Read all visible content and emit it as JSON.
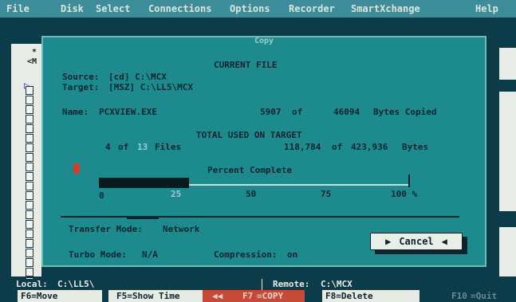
{
  "menu": [
    "File",
    "Disk",
    "Select",
    "Connections",
    "Options",
    "Recorder",
    "SmartXchange",
    "Help"
  ],
  "dialog": {
    "title": "Copy",
    "current_file_heading": "CURRENT FILE",
    "source_label": "Source:",
    "source_value": "[cd] C:\\MCX",
    "target_label": "Target:",
    "target_value": "[MSZ] C:\\LL5\\MCX",
    "name_label": "Name:",
    "name_value": "PCXVIEW.EXE",
    "bytes_copied": "5907",
    "bytes_of": "of",
    "bytes_total": "46094",
    "bytes_suffix": "Bytes Copied",
    "total_heading": "TOTAL USED ON TARGET",
    "files_count": "4",
    "files_of": "of",
    "files_total": "13",
    "files_suffix": "Files",
    "bytes_used": "118,784",
    "bytes_used_of": "of",
    "bytes_capacity": "423,936",
    "bytes_used_suffix": "Bytes",
    "percent_heading": "Percent Complete",
    "percent_value": 0.29,
    "scale": [
      "0",
      "25",
      "50",
      "75",
      "100 %"
    ],
    "transfer_mode_label": "Transfer Mode:",
    "transfer_mode_value": "Network",
    "turbo_mode_label": "Turbo Mode:",
    "turbo_mode_value": "N/A",
    "compression_label": "Compression:",
    "compression_value": "on",
    "cancel_label": "Cancel",
    "cancel_left_icon": "▶",
    "cancel_right_icon": "◀"
  },
  "left_panel": {
    "line1": "*",
    "line2": "<M"
  },
  "status": {
    "local_label": "Local:",
    "local_value": "C:\\LL5\\",
    "remote_label": "Remote:",
    "remote_value": "C:\\MCX"
  },
  "fkeys": [
    {
      "key": "F6",
      "label": "=Move"
    },
    {
      "key": "F5",
      "label": "=Show Time"
    },
    {
      "key": "F7",
      "label": "=COPY"
    },
    {
      "key": "F8",
      "label": "=Delete"
    },
    {
      "key": "F10",
      "label": "=Quit"
    }
  ],
  "colors": {
    "menubar": "#3d8c99",
    "dialog_bg": "#1d8a8d",
    "dark_text": "#0a2430",
    "indicator": "#d23c30",
    "highlight_text": "#9fc8e8"
  }
}
